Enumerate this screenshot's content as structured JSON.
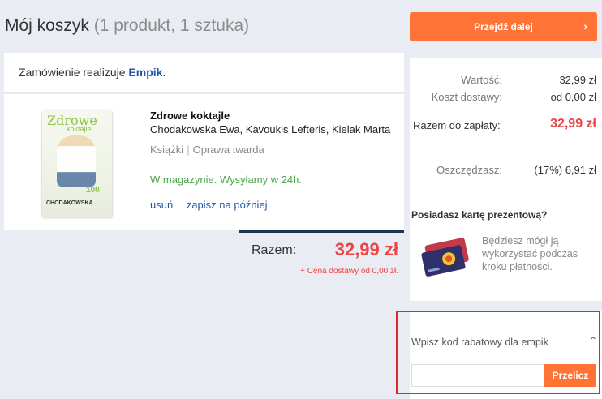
{
  "header": {
    "title": "Mój koszyk",
    "count": "(1 produkt, 1 sztuka)"
  },
  "seller": {
    "prefix": "Zamówienie realizuje ",
    "name": "Empik",
    "suffix": "."
  },
  "product": {
    "cover": {
      "title_line1": "Zdrowe",
      "title_line2": "koktajle",
      "number": "100",
      "author": "CHODAKOWSKA"
    },
    "title": "Zdrowe koktajle",
    "authors": "Chodakowska Ewa, Kavoukis Lefteris, Kielak Marta",
    "category": "Książki",
    "binding": "Oprawa twarda",
    "availability": "W magazynie. Wysyłamy w 24h.",
    "remove_label": "usuń",
    "save_label": "zapisz na później"
  },
  "totals": {
    "label": "Razem:",
    "value": "32,99 zł",
    "delivery_note": "+ Cena dostawy od 0,00 zł."
  },
  "sidebar": {
    "proceed_label": "Przejdź dalej",
    "summary": {
      "value_label": "Wartość:",
      "value": "32,99 zł",
      "shipping_label": "Koszt dostawy:",
      "shipping": "od 0,00 zł",
      "total_label": "Razem do zapłaty:",
      "total": "32,99 zł",
      "savings_label": "Oszczędzasz:",
      "savings": "(17%) 6,91 zł"
    },
    "gift_card": {
      "title": "Posiadasz kartę prezentową?",
      "text": "Będziesz mógł ją wykorzystać podczas kroku płatności."
    },
    "discount": {
      "label": "Wpisz kod rabatowy dla empik",
      "input_value": "",
      "button_label": "Przelicz"
    }
  },
  "colors": {
    "accent": "#ff7337",
    "price": "#ee4444",
    "link": "#1e5aa8",
    "available": "#4aa64a",
    "highlight": "#e0252b"
  },
  "icons": [
    "chevron-right-icon",
    "chevron-up-icon",
    "gift-card-icon"
  ]
}
